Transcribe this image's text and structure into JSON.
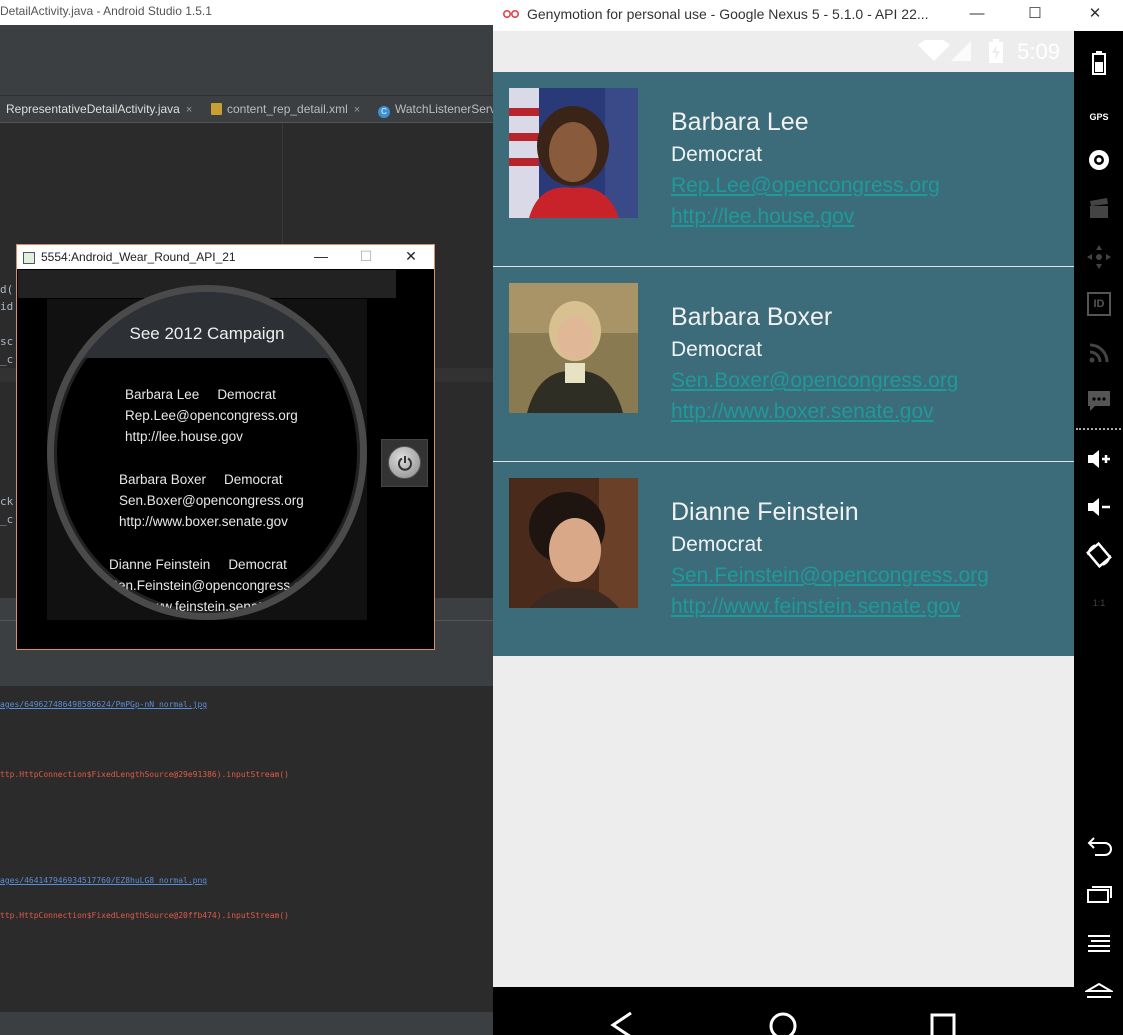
{
  "android_studio": {
    "title": "DetailActivity.java - Android Studio 1.5.1",
    "tabs": [
      {
        "label": "RepresentativeDetailActivity.java",
        "icon": "java-class-icon"
      },
      {
        "label": "content_rep_detail.xml",
        "icon": "xml-file-icon"
      },
      {
        "label": "WatchListenerServi",
        "icon": "java-class-icon"
      }
    ],
    "tab_close": "×",
    "code_fragments": [
      "d(",
      "id",
      "sc",
      "_c",
      "ck",
      "_c"
    ],
    "log_lines": [
      {
        "text": "ages/649627486498586624/PmPGp-nN_normal.jpg",
        "kind": "link"
      },
      {
        "text": "ttp.HttpConnection$FixedLengthSource@29e91386).inputStream()",
        "kind": "error"
      },
      {
        "text": "ages/464147946934517760/EZ8huLG8_normal.png",
        "kind": "link"
      },
      {
        "text": "ttp.HttpConnection$FixedLengthSource@20ffb474).inputStream()",
        "kind": "error"
      }
    ]
  },
  "wear_window": {
    "title": "5554:Android_Wear_Round_API_21",
    "campaign_label": "See 2012 Campaign",
    "entries": [
      {
        "name": "Barbara Lee",
        "party": "Democrat",
        "email": "Rep.Lee@opencongress.org",
        "website": "http://lee.house.gov"
      },
      {
        "name": "Barbara Boxer",
        "party": "Democrat",
        "email": "Sen.Boxer@opencongress.org",
        "website": "http://www.boxer.senate.gov"
      },
      {
        "name": "Dianne Feinstein",
        "party": "Democrat",
        "email": "Sen.Feinstein@opencongress.org",
        "website": "http://www.feinstein.senate.gov"
      }
    ],
    "controls": {
      "minimize": "—",
      "maximize": "☐",
      "close": "✕"
    }
  },
  "genymotion": {
    "title": "Genymotion for personal use - Google Nexus 5 - 5.1.0 - API 22...",
    "controls": {
      "minimize": "—",
      "maximize": "☐",
      "close": "✕"
    },
    "status_time": "5:09",
    "sidebar_icons": [
      "battery-icon",
      "gps-icon",
      "camera-icon",
      "video-capture-icon",
      "dpad-icon",
      "id-icon",
      "network-icon",
      "sms-icon",
      "volume-up-icon",
      "volume-down-icon",
      "rotate-icon",
      "pixel-perfect-icon",
      "back-icon",
      "recent-apps-icon",
      "menu-icon",
      "home-icon"
    ],
    "sidebar_labels": {
      "gps": "GPS",
      "id": "ID",
      "pixel": "1:1"
    }
  },
  "representatives": [
    {
      "name": "Barbara Lee",
      "party": "Democrat",
      "email": "Rep.Lee@opencongress.org",
      "website": "http://lee.house.gov"
    },
    {
      "name": "Barbara Boxer",
      "party": "Democrat",
      "email": "Sen.Boxer@opencongress.org",
      "website": "http://www.boxer.senate.gov"
    },
    {
      "name": "Dianne Feinstein",
      "party": "Democrat",
      "email": "Sen.Feinstein@opencongress.org",
      "website": "http://www.feinstein.senate.gov"
    }
  ],
  "colors": {
    "card_background": "#3c6b7a",
    "link": "#1f9a9a",
    "app_background": "#ededed"
  }
}
